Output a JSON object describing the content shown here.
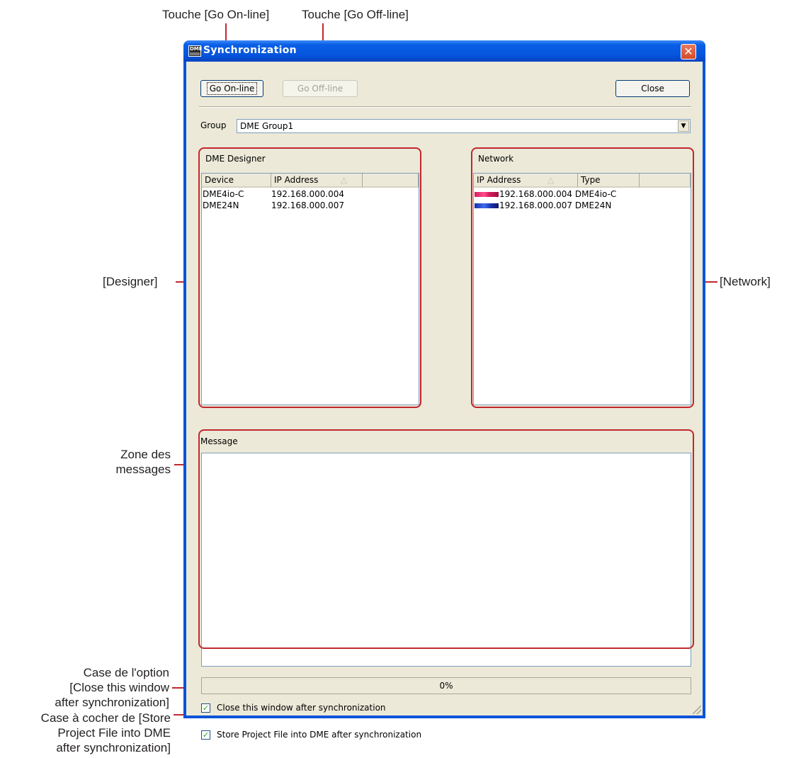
{
  "annotations": {
    "go_online": "Touche [Go On-line]",
    "go_offline": "Touche [Go Off-line]",
    "designer": "[Designer]",
    "network": "[Network]",
    "message_area": [
      "Zone des",
      "messages"
    ],
    "close_option": [
      "Case de l'option",
      "[Close this window",
      "after synchronization]"
    ],
    "store_option": [
      "Case à cocher de [Store",
      "Project File into DME",
      "after synchronization]"
    ]
  },
  "window": {
    "icon_text": "DME",
    "title": "Synchronization",
    "close_glyph": "✕"
  },
  "toolbar": {
    "go_online_label": "Go On-line",
    "go_offline_label": "Go Off-line",
    "close_label": "Close"
  },
  "group": {
    "label": "Group",
    "value": "DME Group1"
  },
  "designer_panel": {
    "title": "DME Designer",
    "columns": [
      "Device",
      "IP Address"
    ],
    "sort_glyph": "△",
    "rows": [
      {
        "device": "DME4io-C",
        "ip": "192.168.000.004"
      },
      {
        "device": "DME24N",
        "ip": "192.168.000.007"
      }
    ]
  },
  "network_panel": {
    "title": "Network",
    "columns": [
      "IP Address",
      "Type"
    ],
    "sort_glyph": "△",
    "rows": [
      {
        "ip": "192.168.000.004",
        "type": "DME4io-C",
        "icon": "dme4io-device-icon",
        "color": "#d81b60"
      },
      {
        "ip": "192.168.000.007",
        "type": "DME24N",
        "icon": "dme24n-device-icon",
        "color": "#1a2fa8"
      }
    ]
  },
  "message": {
    "label": "Message"
  },
  "progress": {
    "value": 0,
    "text": "0%"
  },
  "options": {
    "close_after_sync": {
      "label": "Close this window after synchronization",
      "checked": true
    },
    "store_project": {
      "label": "Store Project File into DME after synchronization",
      "checked": true
    }
  },
  "colors": {
    "annotation_red": "#c1272d",
    "xp_title_blue": "#0a54d8",
    "dialog_face": "#ece9d8"
  }
}
